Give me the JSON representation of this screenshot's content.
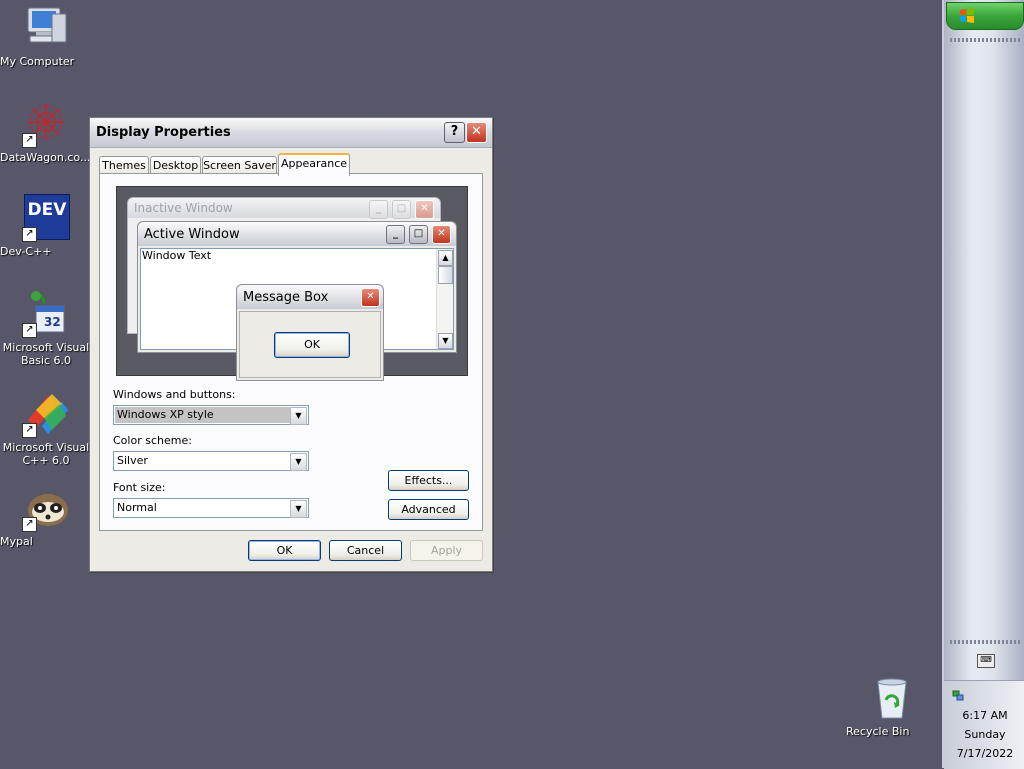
{
  "desktop": {
    "icons": [
      {
        "label": "My Computer",
        "icon": "my-computer-icon"
      },
      {
        "label": "DataWagon.co...",
        "icon": "datawagon-icon"
      },
      {
        "label": "Dev-C++",
        "icon": "devcpp-icon",
        "glyph": "DEV"
      },
      {
        "label": "Microsoft Visual Basic 6.0",
        "icon": "vb6-icon"
      },
      {
        "label": "Microsoft Visual C++ 6.0",
        "icon": "vcpp6-icon"
      },
      {
        "label": "Mypal",
        "icon": "mypal-icon"
      }
    ],
    "recycle_bin": {
      "label": "Recycle Bin"
    }
  },
  "dialog": {
    "title": "Display Properties",
    "help_glyph": "?",
    "close_glyph": "✕",
    "tabs": [
      "Themes",
      "Desktop",
      "Screen Saver",
      "Appearance"
    ],
    "selected_tab": "Appearance",
    "preview": {
      "inactive_title": "Inactive Window",
      "active_title": "Active Window",
      "window_text": "Window Text",
      "message_title": "Message Box",
      "ok": "OK"
    },
    "windows_buttons_label": "Windows and buttons:",
    "windows_buttons_value": "Windows XP style",
    "color_scheme_label": "Color scheme:",
    "color_scheme_value": "Silver",
    "font_size_label": "Font size:",
    "font_size_value": "Normal",
    "effects_button": "Effects...",
    "advanced_button": "Advanced",
    "ok_button": "OK",
    "cancel_button": "Cancel",
    "apply_button": "Apply"
  },
  "taskbar": {
    "clock_time": "6:17 AM",
    "clock_day": "Sunday",
    "clock_date": "7/17/2022"
  },
  "colors": {
    "desktop_bg": "#58576a",
    "close_red": "#c2331d",
    "tab_accent": "#f0b53c",
    "start_green": "#3aa53b"
  }
}
